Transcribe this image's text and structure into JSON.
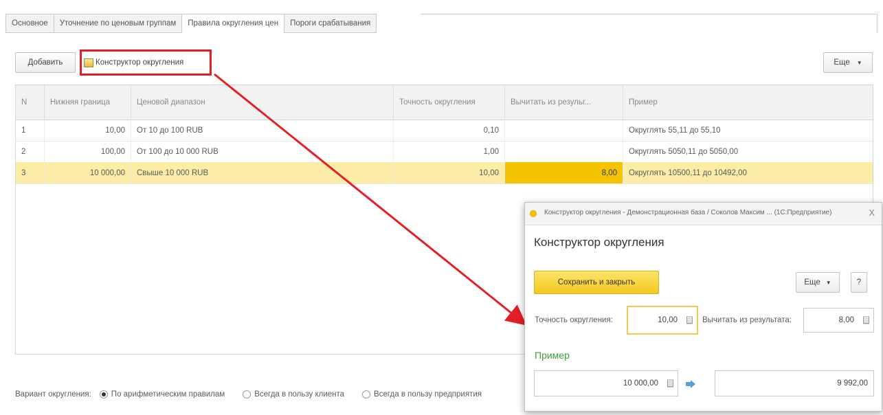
{
  "tabs": [
    "Основное",
    "Уточнение по ценовым группам",
    "Правила округления цен",
    "Пороги срабатывания"
  ],
  "toolbar": {
    "add": "Добавить",
    "constructor": "Конструктор округления",
    "more": "Еще"
  },
  "table": {
    "headers": [
      "N",
      "Нижняя граница",
      "Ценовой диапазон",
      "Точность округления",
      "Вычитать из резульг...",
      "Пример"
    ],
    "rows": [
      {
        "n": "1",
        "lower": "10,00",
        "range": "От 10 до 100 RUB",
        "precision": "0,10",
        "subtract": "",
        "example": "Округлять 55,11 до 55,10"
      },
      {
        "n": "2",
        "lower": "100,00",
        "range": "От 100 до 10 000 RUB",
        "precision": "1,00",
        "subtract": "",
        "example": "Округлять 5050,11 до 5050,00"
      },
      {
        "n": "3",
        "lower": "10 000,00",
        "range": "Свыше 10 000 RUB",
        "precision": "10,00",
        "subtract": "8,00",
        "example": "Округлять 10500,11 до 10492,00"
      }
    ]
  },
  "footer": {
    "label": "Вариант округления:",
    "options": [
      "По арифметическим правилам",
      "Всегда в пользу клиента",
      "Всегда в пользу предприятия"
    ]
  },
  "dialog": {
    "window_title": "Конструктор округления - Демонстрационная база / Соколов Максим ... (1С:Предприятие)",
    "close": "X",
    "heading": "Конструктор округления",
    "save_close": "Сохранить и закрыть",
    "more": "Еще",
    "help": "?",
    "precision_label": "Точность округления:",
    "precision_value": "10,00",
    "subtract_label": "Вычитать из результата:",
    "subtract_value": "8,00",
    "example_heading": "Пример",
    "example_input": "10 000,00",
    "example_result": "9 992,00"
  },
  "colors": {
    "accent_yellow": "#f5c400",
    "selected_row": "#fbeca6",
    "annotation_red": "#e41e26",
    "example_green": "#3a9a3a"
  }
}
